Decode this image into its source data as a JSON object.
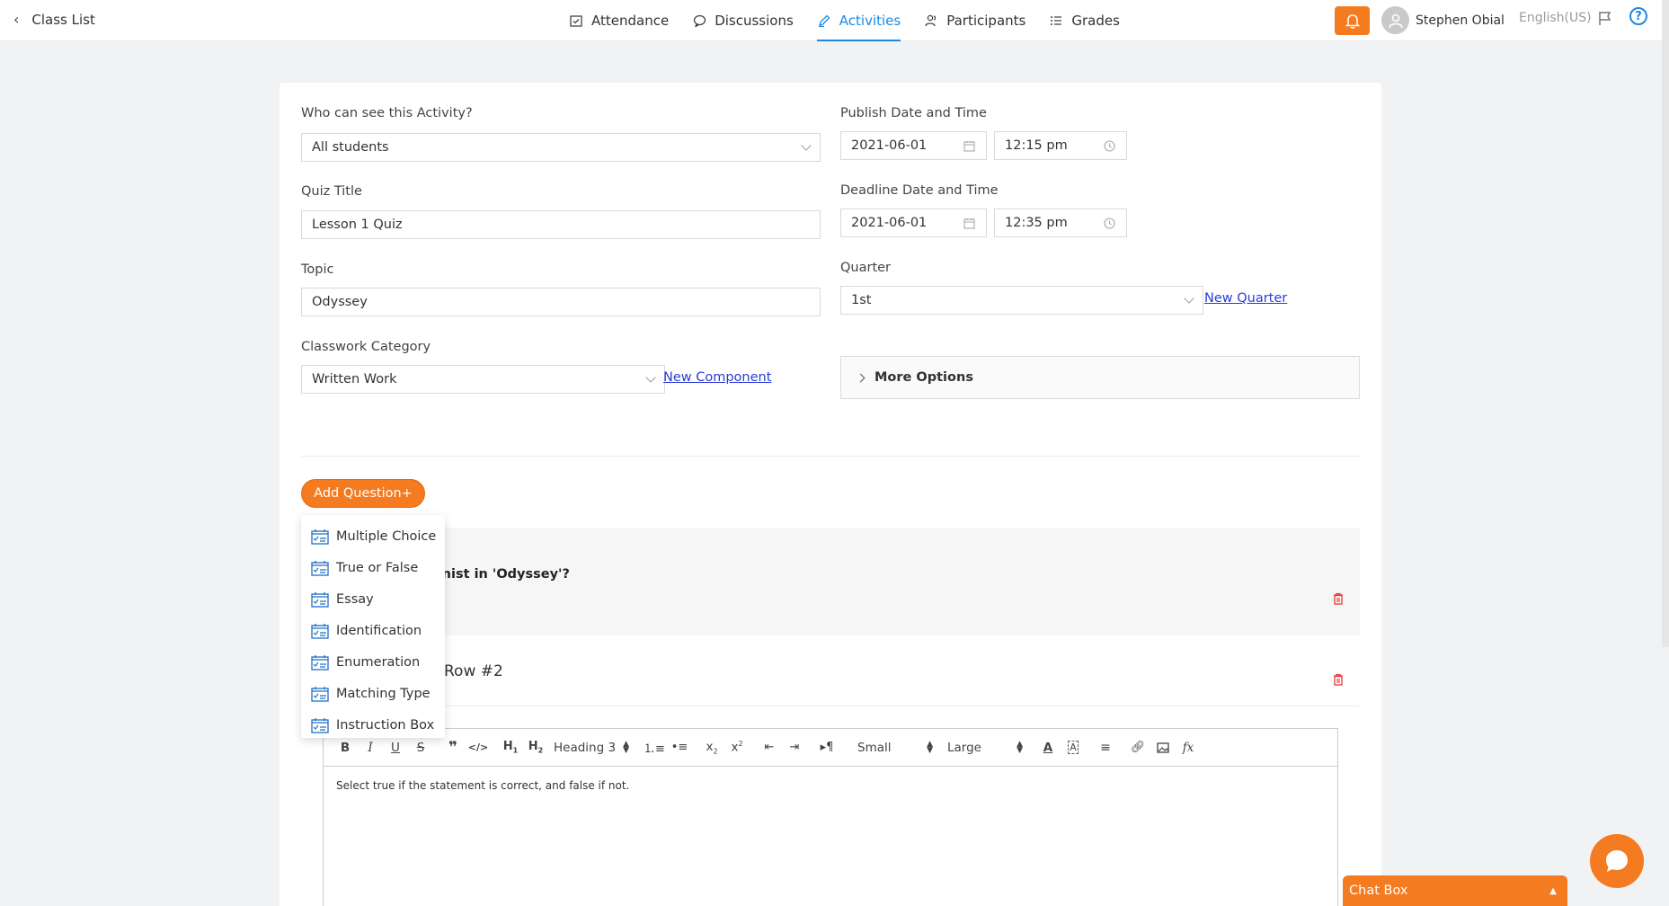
{
  "nav": {
    "back_label": "Class List",
    "items": [
      {
        "label": "Attendance",
        "icon": "calendar-check-icon"
      },
      {
        "label": "Discussions",
        "icon": "chat-icon"
      },
      {
        "label": "Activities",
        "icon": "pen-icon",
        "active": true
      },
      {
        "label": "Participants",
        "icon": "people-icon"
      },
      {
        "label": "Grades",
        "icon": "list-icon"
      }
    ],
    "user_name": "Stephen Obial",
    "language": "English(US)",
    "accent": "#1e88e5",
    "brand_orange": "#f47b20"
  },
  "form": {
    "visibility_label": "Who can see this Activity?",
    "visibility_value": "All students",
    "title_label": "Quiz Title",
    "title_value": "Lesson 1 Quiz",
    "topic_label": "Topic",
    "topic_value": "Odyssey",
    "category_label": "Classwork Category",
    "category_value": "Written Work",
    "new_component": "New Component",
    "publish_label": "Publish Date and Time",
    "publish_date": "2021-06-01",
    "publish_time": "12:15 pm",
    "deadline_label": "Deadline Date and Time",
    "deadline_date": "2021-06-01",
    "deadline_time": "12:35 pm",
    "quarter_label": "Quarter",
    "quarter_value": "1st",
    "new_quarter": "New Quarter",
    "more_options": "More Options"
  },
  "questions": {
    "add_button": "Add Question+",
    "menu": [
      "Multiple Choice",
      "True or False",
      "Essay",
      "Identification",
      "Enumeration",
      "Matching Type",
      "Instruction Box"
    ],
    "q1_text": "Who is the protagonist in 'Odyssey'?",
    "q2_title": "Row #2"
  },
  "editor": {
    "heading_select": "Heading 3",
    "size_small": "Small",
    "size_large": "Large",
    "body_text": "Select true if the statement is correct, and false if not."
  },
  "chat": {
    "label": "Chat Box"
  }
}
